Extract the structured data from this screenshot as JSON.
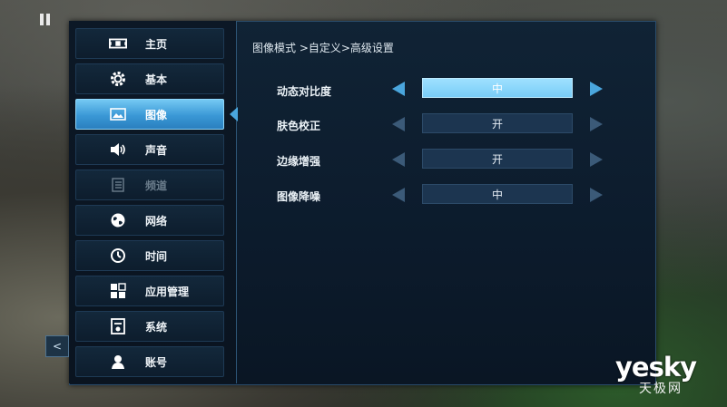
{
  "breadcrumb": "图像模式 >自定义>高级设置",
  "sidebar": {
    "items": [
      {
        "label": "主页",
        "icon": "home-icon"
      },
      {
        "label": "基本",
        "icon": "gear-icon"
      },
      {
        "label": "图像",
        "icon": "picture-icon"
      },
      {
        "label": "声音",
        "icon": "speaker-icon"
      },
      {
        "label": "频道",
        "icon": "list-icon"
      },
      {
        "label": "网络",
        "icon": "globe-icon"
      },
      {
        "label": "时间",
        "icon": "clock-icon"
      },
      {
        "label": "应用管理",
        "icon": "apps-icon"
      },
      {
        "label": "系统",
        "icon": "system-icon"
      },
      {
        "label": "账号",
        "icon": "user-icon"
      }
    ],
    "active_index": 2,
    "disabled_index": 4
  },
  "settings": [
    {
      "label": "动态对比度",
      "value": "中"
    },
    {
      "label": "肤色校正",
      "value": "开"
    },
    {
      "label": "边缘增强",
      "value": "开"
    },
    {
      "label": "图像降噪",
      "value": "中"
    }
  ],
  "side_tab": "<",
  "watermark": {
    "main": "yesky",
    "sub": "天极网"
  },
  "colors": {
    "accent": "#4aa6dd",
    "active_item": "#3a98d6",
    "panel": "#0c1b2c"
  }
}
